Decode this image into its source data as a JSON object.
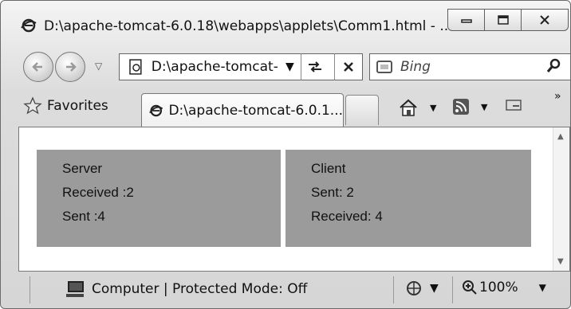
{
  "window": {
    "title": "D:\\apache-tomcat-6.0.18\\webapps\\applets\\Comm1.html - ...",
    "caption_buttons": [
      "minimize",
      "maximize",
      "close"
    ]
  },
  "navigation": {
    "address": "D:\\apache-tomcat-",
    "search_placeholder": "Bing"
  },
  "favorites_bar": {
    "favorites_label": "Favorites",
    "active_tab": "D:\\apache-tomcat-6.0.1..."
  },
  "page": {
    "server": {
      "title": "Server",
      "received": "Received :2",
      "sent": "Sent :4"
    },
    "client": {
      "title": "Client",
      "sent": "Sent: 2",
      "received": "Received: 4"
    }
  },
  "status_bar": {
    "zone": "Computer | Protected Mode: Off",
    "zoom": "100%"
  },
  "icons": [
    "ie-page-icon",
    "back-icon",
    "forward-icon",
    "refresh-icon",
    "stop-icon",
    "bing-icon",
    "search-icon",
    "favorites-star-icon",
    "home-icon",
    "feed-icon",
    "read-mail-icon",
    "computer-icon",
    "zone-icon",
    "zoom-icon"
  ]
}
